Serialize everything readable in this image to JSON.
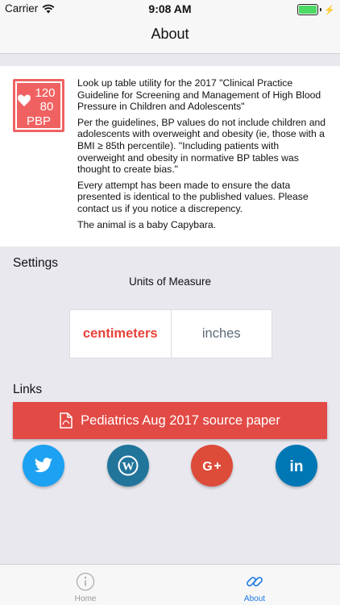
{
  "status_bar": {
    "carrier": "Carrier",
    "time": "9:08 AM"
  },
  "nav": {
    "title": "About"
  },
  "logo": {
    "line1": "120",
    "line2": "80",
    "line3": "PBP"
  },
  "about": {
    "p1": "Look up table utility for the 2017 \"Clinical Practice Guideline for Screening and Management of High Blood Pressure in Children and Adolescents\"",
    "p2": "Per the guidelines, BP values do not include children and adolescents with overweight and obesity (ie, those with a BMI ≥ 85th percentile). \"Including patients with overweight and obesity in normative BP tables was thought to create bias.\"",
    "p3": "Every attempt has been made to ensure the data presented is identical to the published values. Please contact us if you notice a discrepency.",
    "p4": "The animal is a baby Capybara."
  },
  "settings": {
    "title": "Settings",
    "units_label": "Units of Measure",
    "options": [
      "centimeters",
      "inches"
    ],
    "selected": "centimeters"
  },
  "links": {
    "title": "Links",
    "source_button": "Pediatrics Aug 2017 source paper",
    "social": [
      {
        "name": "twitter",
        "color": "#1da1f2",
        "icon": "twitter-icon"
      },
      {
        "name": "wordpress",
        "color": "#21759b",
        "icon": "wordpress-icon"
      },
      {
        "name": "google-plus",
        "color": "#dd4b39",
        "icon": "google-plus-icon"
      },
      {
        "name": "linkedin",
        "color": "#0077b5",
        "icon": "linkedin-icon"
      }
    ]
  },
  "tabbar": {
    "items": [
      {
        "label": "Home",
        "icon": "info-icon",
        "active": false
      },
      {
        "label": "About",
        "icon": "link-icon",
        "active": true
      }
    ]
  },
  "colors": {
    "accent": "#e24a45",
    "active_tab": "#1a7ae6",
    "inactive_tab": "#999999"
  }
}
